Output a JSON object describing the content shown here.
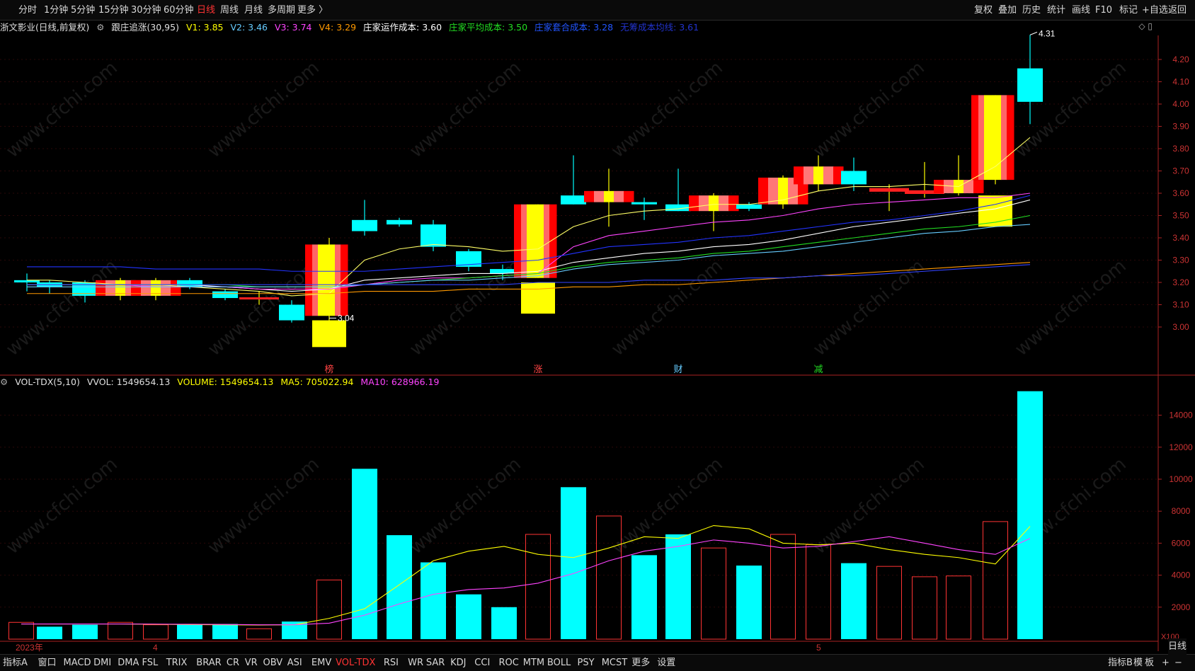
{
  "topbar": {
    "periods": [
      "分时",
      "1分钟",
      "5分钟",
      "15分钟",
      "30分钟",
      "60分钟",
      "日线",
      "周线",
      "月线",
      "多周期",
      "更多 〉"
    ],
    "active_period": "日线",
    "right_tools": [
      "复权",
      "叠加",
      "历史",
      "统计",
      "画线",
      "F10",
      "标记",
      "+自选",
      "返回"
    ]
  },
  "info": {
    "stock": "浙文影业(日线,前复权)",
    "indicator": "跟庄追涨(30,95)",
    "v1": "V1: 3.85",
    "v2": "V2: 3.46",
    "v3": "V3: 3.74",
    "v4": "V4: 3.29",
    "cost1": "庄家运作成本: 3.60",
    "cost2": "庄家平均成本: 3.50",
    "cost3": "庄家套合成本: 3.28",
    "cost4": "无筹成本均线: 3.61"
  },
  "volinfo": {
    "name": "VOL-TDX(5,10)",
    "vvol": "VVOL: 1549654.13",
    "volume": "VOLUME: 1549654.13",
    "ma5": "MA5: 705022.94",
    "ma10": "MA10: 628966.19"
  },
  "price_axis": [
    "4.20",
    "4.10",
    "4.00",
    "3.90",
    "3.80",
    "3.70",
    "3.60",
    "3.50",
    "3.40",
    "3.30",
    "3.20",
    "3.10",
    "3.00"
  ],
  "vol_axis": [
    "14000",
    "12000",
    "10000",
    "8000",
    "6000",
    "4000",
    "2000"
  ],
  "vol_unit": "X100",
  "high_label": "4.31",
  "low_label": "3.04",
  "signal_labels": [
    "榜",
    "涨",
    "财",
    "减"
  ],
  "date_labels": [
    "2023年",
    "4",
    "5"
  ],
  "bottombar": {
    "left": [
      "指标A",
      "窗口"
    ],
    "indicators": [
      "MACD",
      "DMI",
      "DMA",
      "FSL",
      "TRIX",
      "BRAR",
      "CR",
      "VR",
      "OBV",
      "ASI",
      "EMV",
      "VOL-TDX",
      "RSI",
      "WR",
      "SAR",
      "KDJ",
      "CCI",
      "ROC",
      "MTM",
      "BOLL",
      "PSY",
      "MCST",
      "更多",
      "设置"
    ],
    "active_indicator": "VOL-TDX",
    "right": [
      "指标B",
      "模",
      "板",
      "+",
      "−",
      "日线"
    ]
  },
  "watermark": "www.cfchi.com",
  "colors": {
    "up": "#ff2020",
    "down": "#00ffff",
    "v1": "#ffff00",
    "v2": "#66ccff",
    "v3": "#ff44ff",
    "v4": "#ff9900"
  }
}
